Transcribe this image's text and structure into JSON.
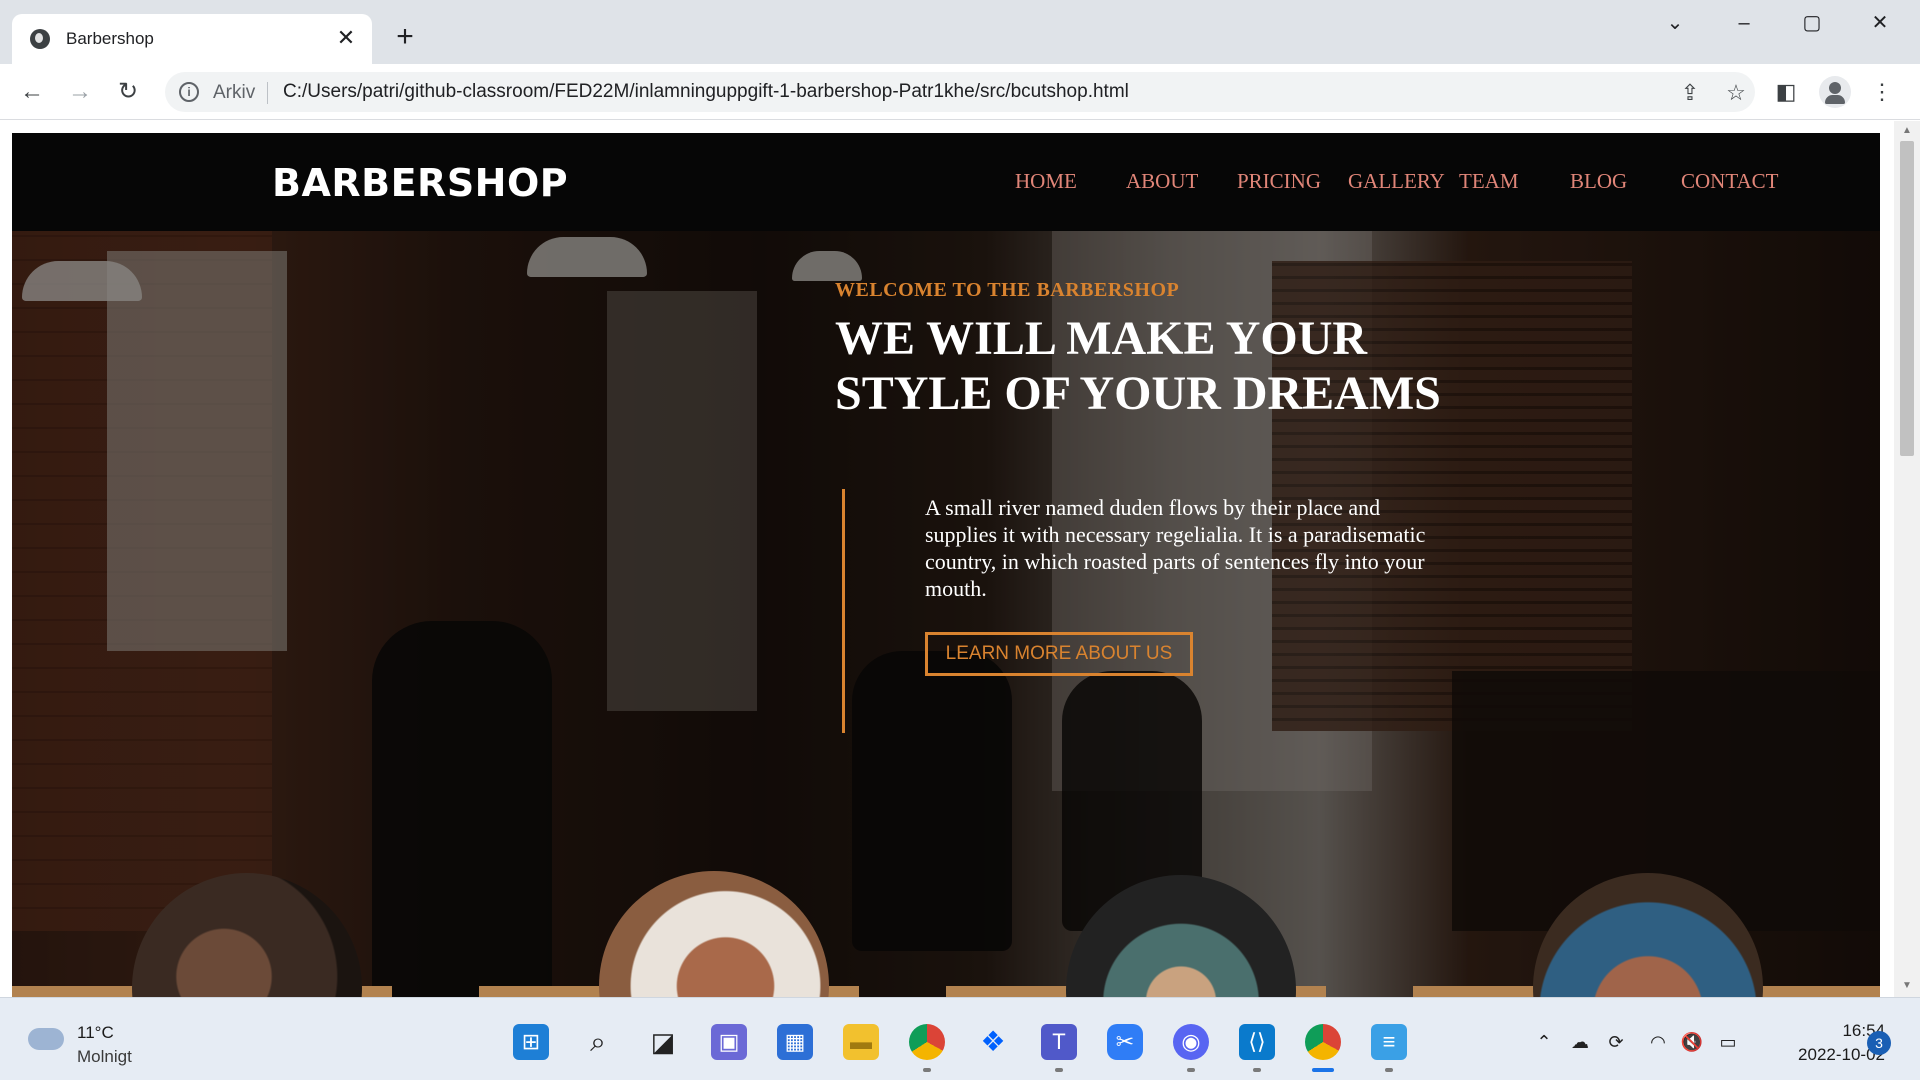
{
  "browser": {
    "tab_title": "Barbershop",
    "tab_close": "✕",
    "new_tab": "+",
    "omnibox_scheme": "Arkiv",
    "url": "C:/Users/patri/github-classroom/FED22M/inlamninguppgift-1-barbershop-Patr1khe/src/bcutshop.html"
  },
  "site": {
    "brand": "BARBERSHOP",
    "nav": [
      "HOME",
      "ABOUT",
      "PRICING",
      "GALLERY",
      "TEAM",
      "BLOG",
      "CONTACT"
    ],
    "hero": {
      "eyebrow": "WELCOME TO THE BARBERSHOP",
      "headline": "WE WILL MAKE YOUR STYLE OF YOUR DREAMS",
      "lead": "A small river named duden flows by their place and supplies it with necessary regelialia. It is a paradisematic country, in which roasted parts of sentences fly into your mouth.",
      "cta": "LEARN MORE ABOUT US"
    },
    "colors": {
      "accent": "#d9832f",
      "nav_link": "#e08578",
      "header_bg": "#060606",
      "band": "#b2824f"
    }
  },
  "taskbar": {
    "weather_temp": "11°C",
    "weather_desc": "Molnigt",
    "time": "16:54",
    "date": "2022-10-02",
    "notification_count": "3",
    "apps": [
      "windows-start",
      "search",
      "task-view",
      "chat",
      "store",
      "file-explorer",
      "chrome",
      "dropbox",
      "teams",
      "snipping-tool",
      "discord",
      "vscode",
      "chrome-active",
      "notepad"
    ]
  }
}
